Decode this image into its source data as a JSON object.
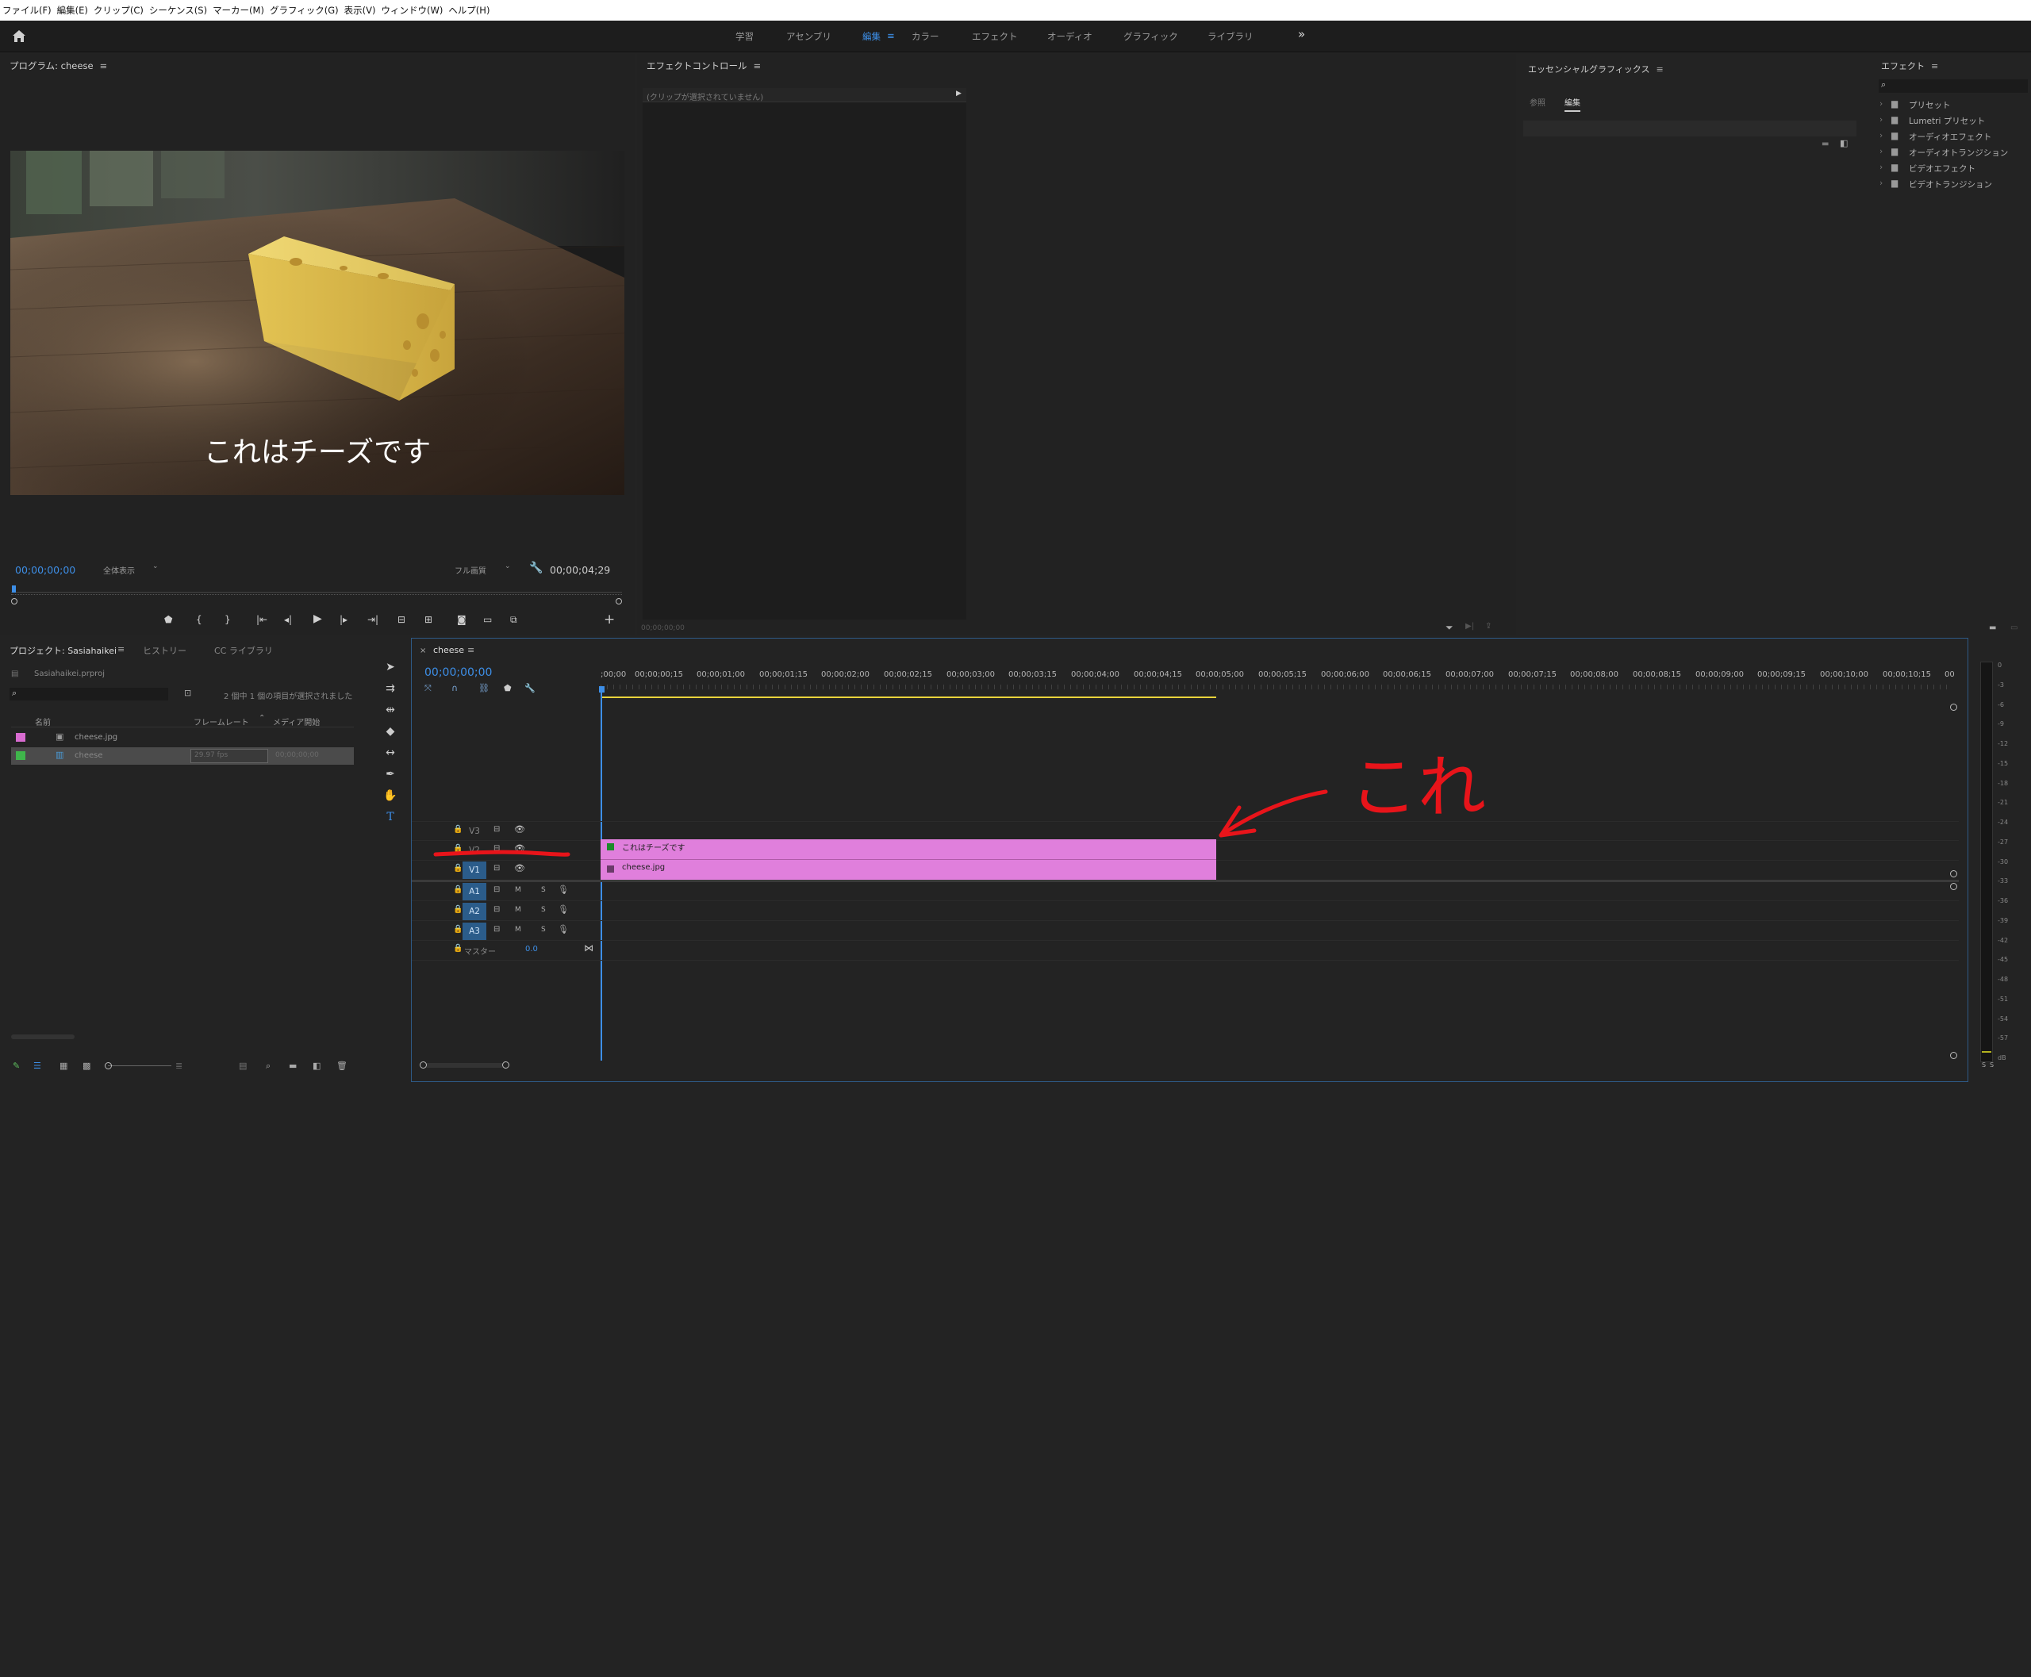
{
  "menu": [
    "ファイル(F)",
    "編集(E)",
    "クリップ(C)",
    "シーケンス(S)",
    "マーカー(M)",
    "グラフィック(G)",
    "表示(V)",
    "ウィンドウ(W)",
    "ヘルプ(H)"
  ],
  "workspaces": [
    "学習",
    "アセンブリ",
    "編集",
    "カラー",
    "エフェクト",
    "オーディオ",
    "グラフィック",
    "ライブラリ"
  ],
  "active_workspace": "編集",
  "program": {
    "title": "プログラム: cheese",
    "caption": "これはチーズです",
    "timecode_left": "00;00;00;00",
    "zoom": "全体表示",
    "quality": "フル画質",
    "timecode_right": "00;00;04;29"
  },
  "effect_controls": {
    "title": "エフェクトコントロール",
    "empty_msg": "(クリップが選択されていません)",
    "timecode": "00;00;00;00"
  },
  "essential_graphics": {
    "title": "エッセンシャルグラフィックス",
    "tabs": [
      "参照",
      "編集"
    ],
    "active_tab": "編集"
  },
  "effects": {
    "title": "エフェクト",
    "items": [
      "プリセット",
      "Lumetri プリセット",
      "オーディオエフェクト",
      "オーディオトランジション",
      "ビデオエフェクト",
      "ビデオトランジション"
    ]
  },
  "project": {
    "tabs": [
      "プロジェクト: Sasiahaikei",
      "ヒストリー",
      "CC ライブラリ"
    ],
    "file": "Sasiahaikei.prproj",
    "selection": "2 個中 1 個の項目が選択されました",
    "columns": [
      "名前",
      "フレームレート",
      "メディア開始"
    ],
    "items": [
      {
        "name": "cheese.jpg",
        "color": "#d86bd0",
        "fps": "",
        "start": ""
      },
      {
        "name": "cheese",
        "color": "#3fb54b",
        "fps": "29.97 fps",
        "start": "00;00;00;00"
      }
    ]
  },
  "timeline": {
    "sequence": "cheese",
    "timecode": "00;00;00;00",
    "ruler": [
      ";00;00",
      "00;00;00;15",
      "00;00;01;00",
      "00;00;01;15",
      "00;00;02;00",
      "00;00;02;15",
      "00;00;03;00",
      "00;00;03;15",
      "00;00;04;00",
      "00;00;04;15",
      "00;00;05;00",
      "00;00;05;15",
      "00;00;06;00",
      "00;00;06;15",
      "00;00;07;00",
      "00;00;07;15",
      "00;00;08;00",
      "00;00;08;15",
      "00;00;09;00",
      "00;00;09;15",
      "00;00;10;00",
      "00;00;10;15",
      "00"
    ],
    "video_tracks": [
      "V3",
      "V2",
      "V1"
    ],
    "audio_tracks": [
      "A1",
      "A2",
      "A3"
    ],
    "master_label": "マスター",
    "master_value": "0.0",
    "clips": [
      {
        "track": "V2",
        "name": "これはチーズです"
      },
      {
        "track": "V1",
        "name": "cheese.jpg"
      }
    ],
    "clip_color": "#e07fdc",
    "annotation": "これ",
    "annotation_color": "#e8141a"
  },
  "meter": {
    "ticks": [
      "0",
      "-3",
      "-6",
      "-9",
      "-12",
      "-15",
      "-18",
      "-21",
      "-24",
      "-27",
      "-30",
      "-33",
      "-36",
      "-39",
      "-42",
      "-45",
      "-48",
      "-51",
      "-54",
      "-57",
      "dB"
    ],
    "solo": [
      "S",
      "S"
    ]
  }
}
